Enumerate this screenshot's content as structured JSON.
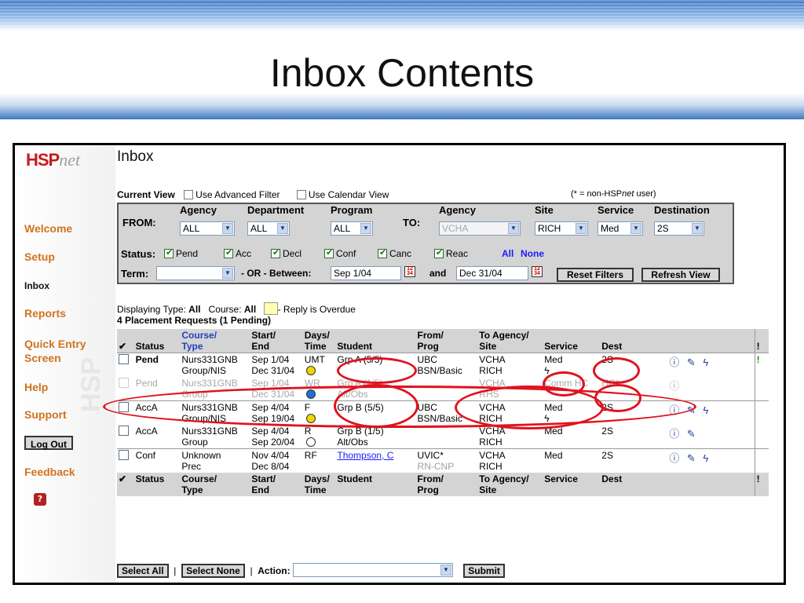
{
  "slide": {
    "title": "Inbox Contents"
  },
  "nav": {
    "logo_main": "HSP",
    "logo_net": "net",
    "items": [
      {
        "label": "Welcome"
      },
      {
        "label": "Setup"
      },
      {
        "label": "Inbox"
      },
      {
        "label": "Reports"
      },
      {
        "label": "Quick Entry Screen"
      },
      {
        "label": "Help"
      },
      {
        "label": "Support"
      },
      {
        "label": "Log Out"
      },
      {
        "label": "Feedback"
      }
    ]
  },
  "page": {
    "heading": "Inbox"
  },
  "current_view": {
    "label": "Current View",
    "advanced_filter": "Use Advanced Filter",
    "calendar_view": "Use Calendar View",
    "non_user_note": "(* = non-HSP",
    "non_user_net": "net",
    "non_user_tail": " user)"
  },
  "filters": {
    "from_label": "FROM:",
    "to_label": "TO:",
    "agency_header": "Agency",
    "department_header": "Department",
    "program_header": "Program",
    "to_agency_header": "Agency",
    "site_header": "Site",
    "service_header": "Service",
    "destination_header": "Destination",
    "from_agency": "ALL",
    "from_department": "ALL",
    "from_program": "ALL",
    "to_agency": "VCHA",
    "to_site": "RICH",
    "to_service": "Med",
    "to_destination": "2S",
    "status_label": "Status:",
    "statuses": [
      "Pend",
      "Acc",
      "Decl",
      "Conf",
      "Canc",
      "Reac"
    ],
    "all_link": "All",
    "none_link": "None",
    "term_label": "Term:",
    "or_between": "- OR -  Between:",
    "start_date": "Sep 1/04",
    "and_label": "and",
    "end_date": "Dec 31/04",
    "reset_button": "Reset Filters",
    "refresh_button": "Refresh View"
  },
  "summary": {
    "displaying_type_label": "Displaying Type: ",
    "displaying_type_value": "All",
    "course_label": "Course: ",
    "course_value": "All",
    "overdue_note": "- Reply is Overdue",
    "count_line": "4 Placement Requests (1 Pending)"
  },
  "table": {
    "header": {
      "check": "✔",
      "status": "Status",
      "course1": "Course/",
      "course2": "Type",
      "start1": "Start/",
      "start2": "End",
      "days1": "Days/",
      "days2": "Time",
      "student": "Student",
      "from1": "From/",
      "from2": "Prog",
      "to1": "To Agency/",
      "to2": "Site",
      "service": "Service",
      "dest": "Dest",
      "excl": "!"
    },
    "rows": [
      {
        "status": "Pend",
        "course1": "Nurs331GNB",
        "course2": "Group/NIS",
        "start": "Sep 1/04",
        "end": "Dec 31/04",
        "days": "UMT",
        "student1": "Grp A (5/5)",
        "student2": "",
        "from1": "UBC",
        "from2": "BSN/Basic",
        "to1": "VCHA",
        "to2": "RICH",
        "service": "Med",
        "service2": "ϟ",
        "dest": "2S",
        "actions": "ⓘ ✎ ϟ",
        "flag": "!"
      },
      {
        "status": "Pend",
        "course1": "Nurs331GNB",
        "course2": "Group",
        "start": "Sep 1/04",
        "end": "Dec 31/04",
        "days": "WR",
        "student1": "Grp A (1/5)",
        "student2": "Alt/Obs",
        "from1": "",
        "from2": "",
        "to1": "VCHA",
        "to2": "RHS",
        "service": "Comm HC",
        "service2": "",
        "dest": "HC*",
        "actions": "ⓘ",
        "flag": ""
      },
      {
        "status": "AccA",
        "course1": "Nurs331GNB",
        "course2": "Group/NIS",
        "start": "Sep 4/04",
        "end": "Sep 19/04",
        "days": "F",
        "student1": "Grp B (5/5)",
        "student2": "",
        "from1": "UBC",
        "from2": "BSN/Basic",
        "to1": "VCHA",
        "to2": "RICH",
        "service": "Med",
        "service2": "ϟ",
        "dest": "2S",
        "actions": "ⓘ ✎ ϟ",
        "flag": ""
      },
      {
        "status": "AccA",
        "course1": "Nurs331GNB",
        "course2": "Group",
        "start": "Sep 4/04",
        "end": "Sep 20/04",
        "days": "R",
        "student1": "Grp B (1/5)",
        "student2": "Alt/Obs",
        "from1": "",
        "from2": "",
        "to1": "VCHA",
        "to2": "RICH",
        "service": "Med",
        "service2": "",
        "dest": "2S",
        "actions": "ⓘ ✎",
        "flag": ""
      },
      {
        "status": "Conf",
        "course1": "Unknown",
        "course2": "Prec",
        "start": "Nov 4/04",
        "end": "Dec 8/04",
        "days": "RF",
        "student1": "Thompson, C",
        "student2": "",
        "from1": "UVIC*",
        "from2": "RN-CNP",
        "to1": "VCHA",
        "to2": "RICH",
        "service": "Med",
        "service2": "",
        "dest": "2S",
        "actions": "ⓘ ✎ ϟ",
        "flag": ""
      }
    ]
  },
  "action_bar": {
    "select_all": "Select All",
    "select_none": "Select None",
    "action_label": "Action:",
    "action_value": "",
    "submit": "Submit"
  },
  "colors": {
    "annotation": "#e0121d",
    "nav_link": "#d0731f",
    "logo_red": "#c8191c"
  }
}
